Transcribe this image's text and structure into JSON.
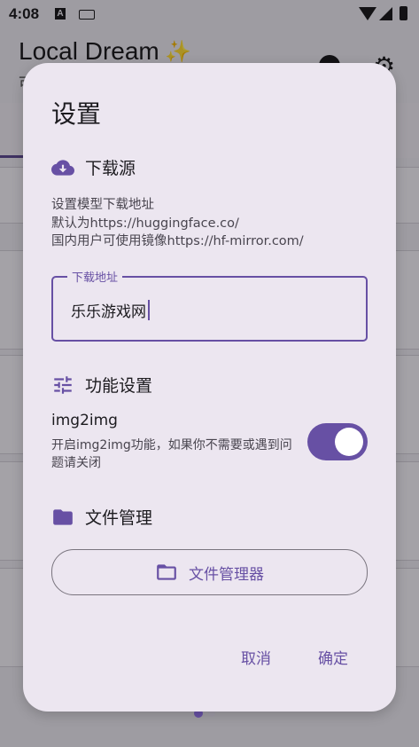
{
  "status_bar": {
    "time": "4:08",
    "icons": [
      "a-notification-icon",
      "keyboard-icon",
      "wifi-icon",
      "signal-icon",
      "battery-icon"
    ]
  },
  "app_header": {
    "title": "Local Dream",
    "title_icon": "sparkle-icon",
    "subtitle_partial": "可",
    "actions": [
      "help-icon",
      "gear-icon"
    ]
  },
  "dialog": {
    "title": "设置",
    "download_section": {
      "icon": "cloud-download-icon",
      "title": "下载源",
      "desc_lines": [
        "设置模型下载地址",
        "默认为https://huggingface.co/",
        "国内用户可使用镜像https://hf-mirror.com/"
      ],
      "field_label": "下载地址",
      "field_value": "乐乐游戏网"
    },
    "feature_section": {
      "icon": "tune-icon",
      "title": "功能设置",
      "img2img_title": "img2img",
      "img2img_desc": "开启img2img功能，如果你不需要或遇到问题请关闭",
      "img2img_enabled": true
    },
    "file_section": {
      "icon": "folder-icon",
      "title": "文件管理",
      "button_icon": "folder-outline-icon",
      "button_label": "文件管理器"
    },
    "actions": {
      "cancel": "取消",
      "confirm": "确定"
    }
  },
  "pager": {
    "pages": 2,
    "current": 1
  },
  "colors": {
    "primary": "#6750a4",
    "dialog_bg": "#ece6f0",
    "text": "#1c1b1f",
    "secondary_text": "#49454f"
  }
}
